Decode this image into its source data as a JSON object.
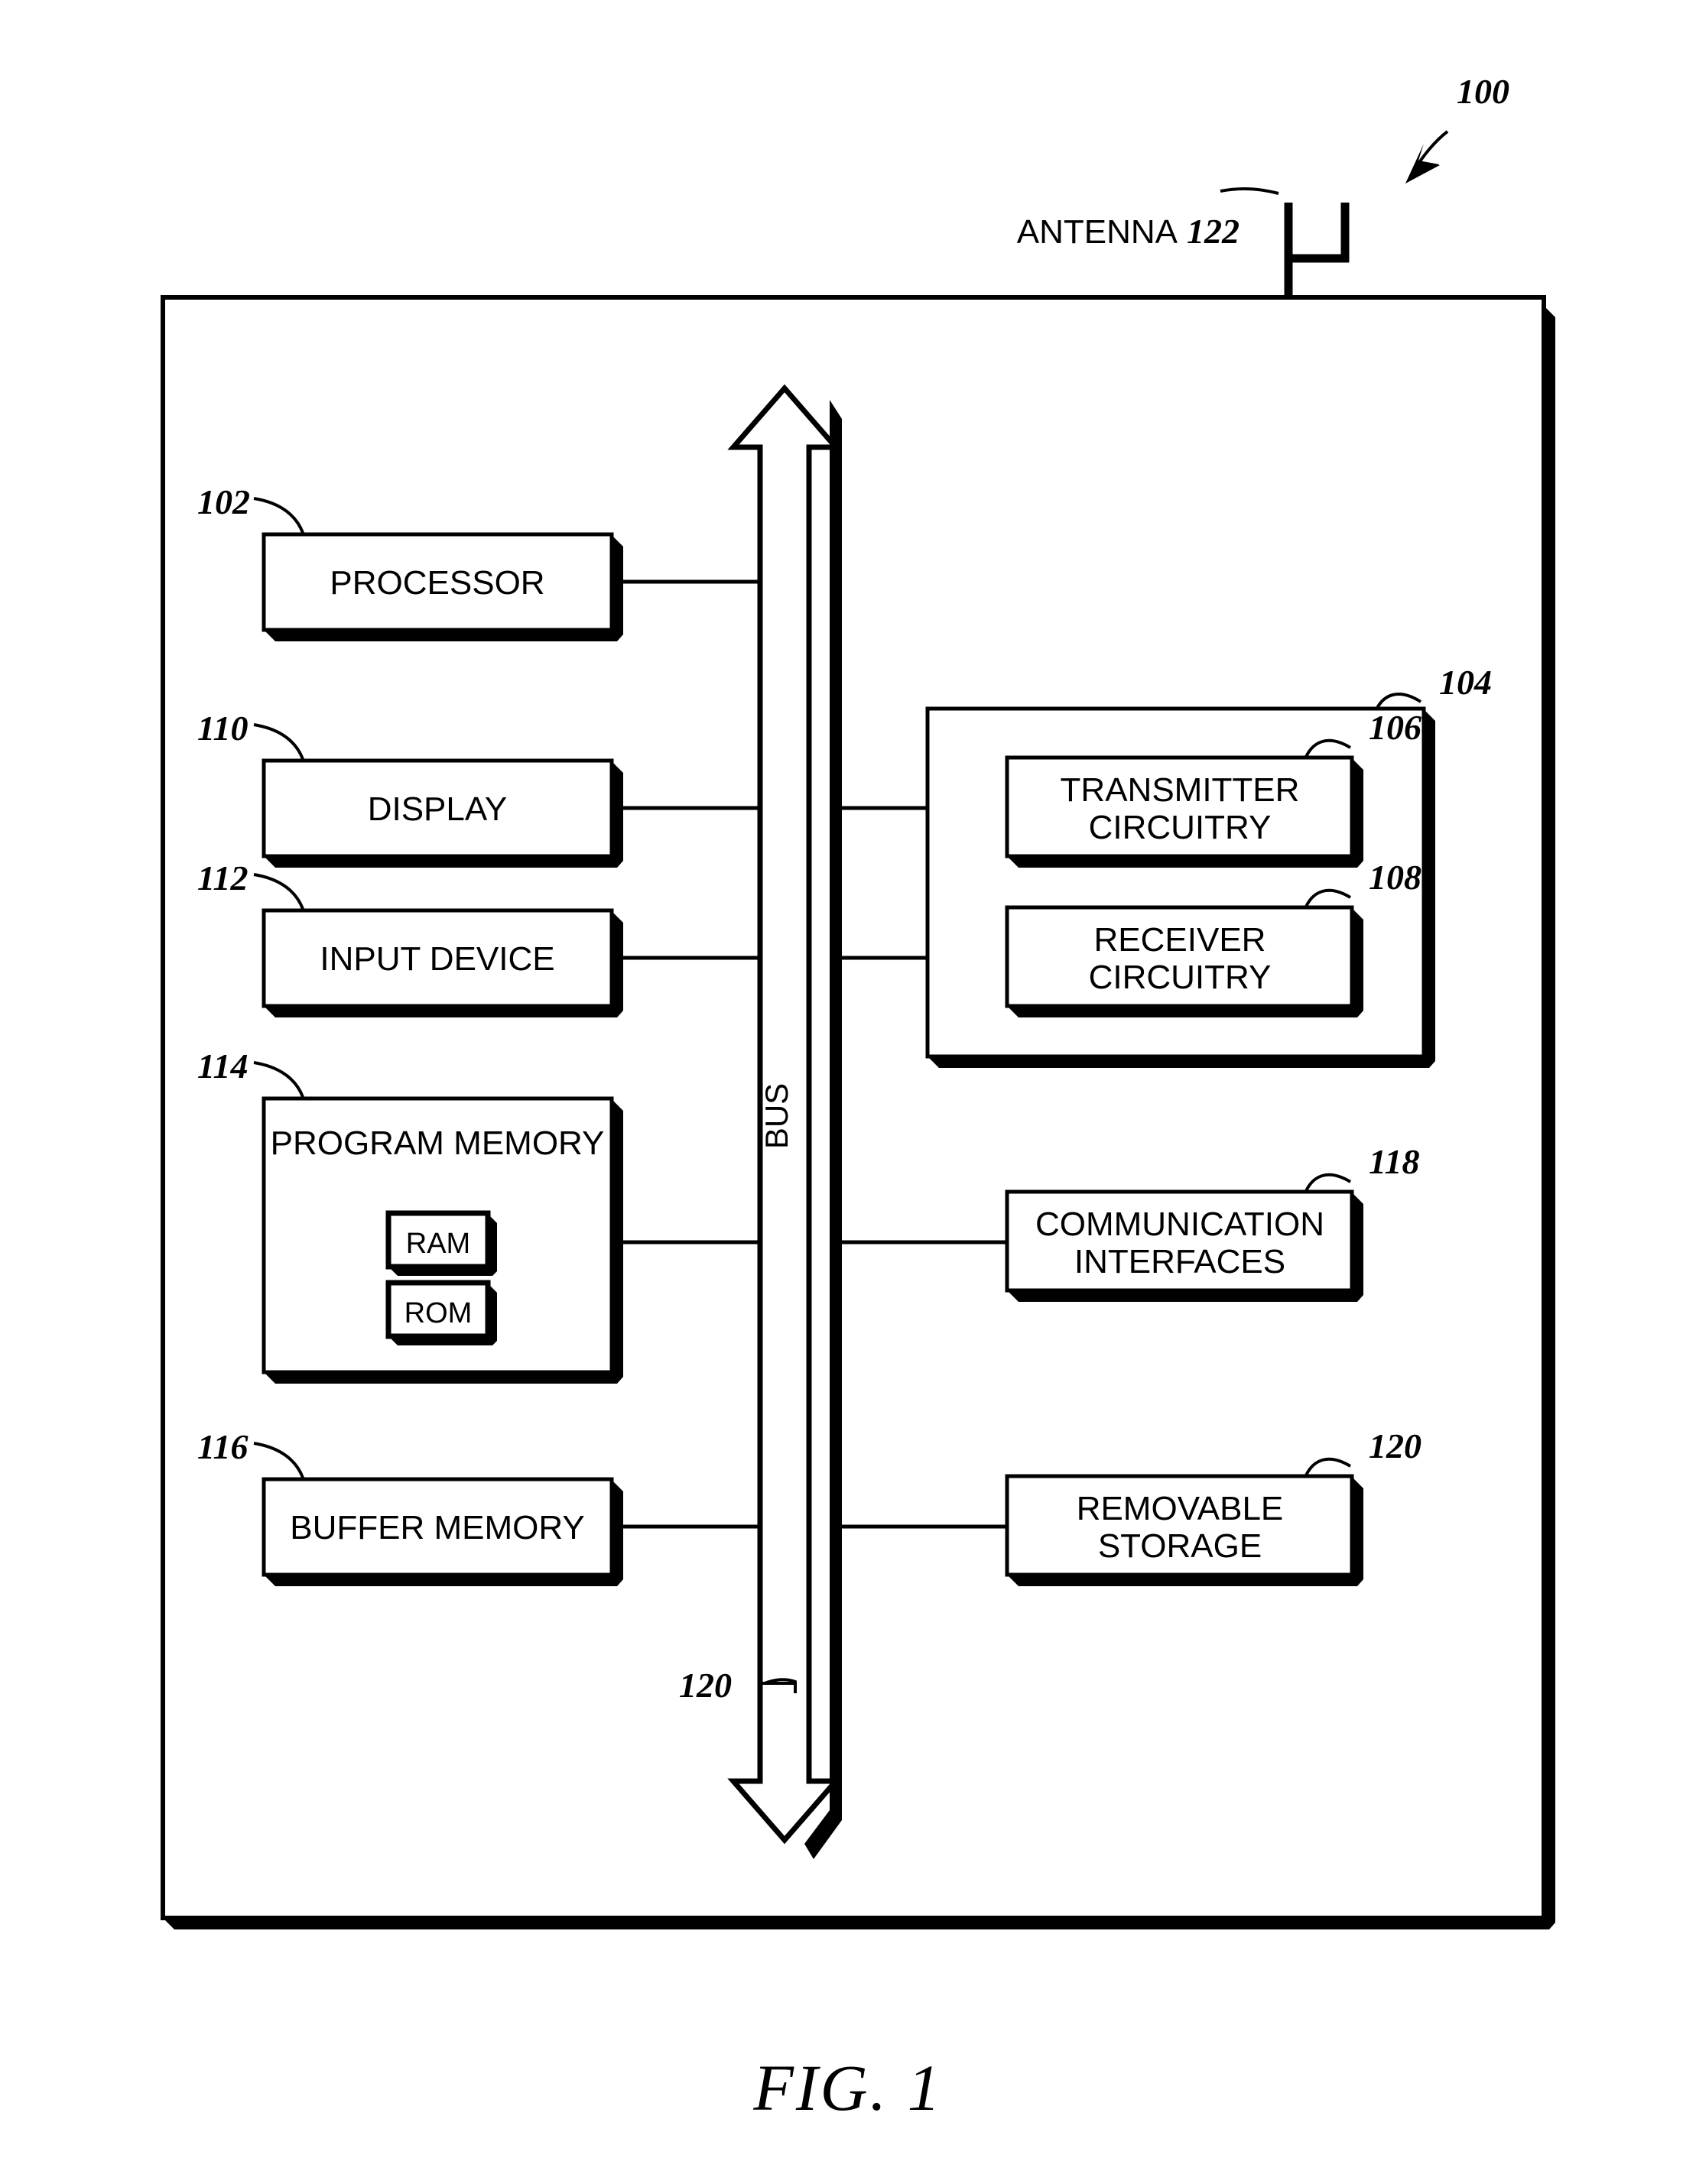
{
  "figure": {
    "caption": "FIG. 1",
    "system_ref": "100"
  },
  "antenna": {
    "label": "ANTENNA",
    "ref": "122",
    "icon": "antenna-icon"
  },
  "device_boundary": {
    "name": "wireless-device-enclosure"
  },
  "bus": {
    "label": "BUS",
    "ref": "120",
    "direction": "bidirectional"
  },
  "left_column": [
    {
      "id": "processor",
      "label": "PROCESSOR",
      "ref": "102"
    },
    {
      "id": "display",
      "label": "DISPLAY",
      "ref": "110"
    },
    {
      "id": "input-device",
      "label": "INPUT DEVICE",
      "ref": "112"
    },
    {
      "id": "program-memory",
      "label": "PROGRAM MEMORY",
      "ref": "114"
    },
    {
      "id": "buffer-memory",
      "label": "BUFFER MEMORY",
      "ref": "116"
    }
  ],
  "program_memory_children": [
    {
      "id": "ram",
      "label": "RAM"
    },
    {
      "id": "rom",
      "label": "ROM"
    }
  ],
  "transceiver": {
    "ref": "104",
    "children": [
      {
        "id": "transmitter-circuitry",
        "line1": "TRANSMITTER",
        "line2": "CIRCUITRY",
        "ref": "106"
      },
      {
        "id": "receiver-circuitry",
        "line1": "RECEIVER",
        "line2": "CIRCUITRY",
        "ref": "108"
      }
    ]
  },
  "right_column": [
    {
      "id": "communication-interfaces",
      "line1": "COMMUNICATION",
      "line2": "INTERFACES",
      "ref": "118"
    },
    {
      "id": "removable-storage",
      "line1": "REMOVABLE",
      "line2": "STORAGE",
      "ref": "120"
    }
  ],
  "colors": {
    "ink": "#000000",
    "paper": "#ffffff"
  }
}
